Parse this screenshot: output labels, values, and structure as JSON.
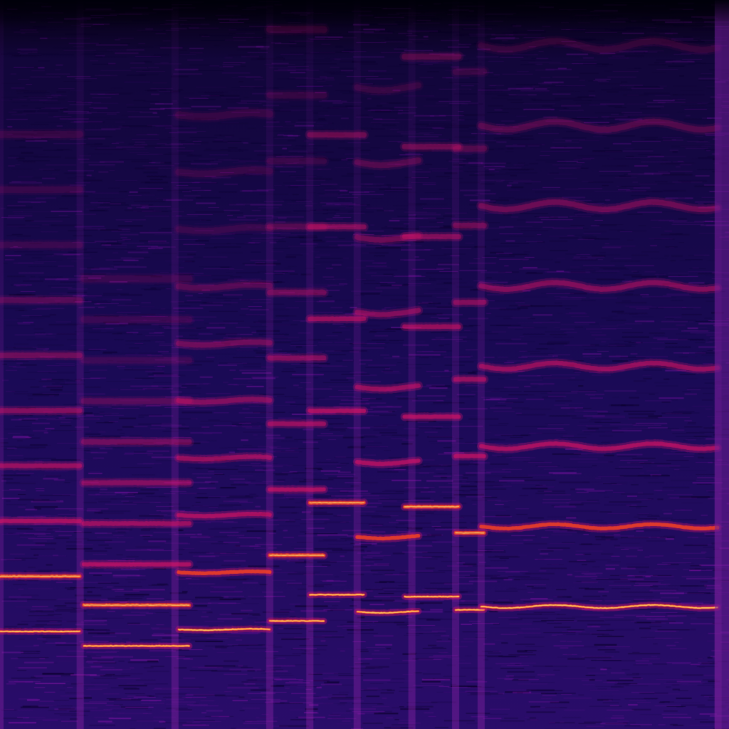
{
  "image": {
    "subject": "spectrogram",
    "colormap": "magma-like",
    "colors": {
      "background_top": "#05000f",
      "background_mid": "#1a0a55",
      "noise_violet": "#6a0a9a",
      "harmonic_low": "#d4146a",
      "harmonic_high": "#ff3a1a",
      "peak": "#ffe060"
    }
  },
  "segments": [
    {
      "t0": 0.0,
      "t1": 0.11,
      "f0": 0.082,
      "vib": 0.0,
      "n": 10
    },
    {
      "t0": 0.115,
      "t1": 0.26,
      "f0": 0.06,
      "vib": 0.0,
      "n": 10
    },
    {
      "t0": 0.245,
      "t1": 0.37,
      "f0": 0.085,
      "vib": 0.15,
      "n": 10
    },
    {
      "t0": 0.37,
      "t1": 0.445,
      "f0": 0.098,
      "vib": 0.0,
      "n": 10
    },
    {
      "t0": 0.425,
      "t1": 0.5,
      "f0": 0.138,
      "vib": 0.0,
      "n": 6
    },
    {
      "t0": 0.49,
      "t1": 0.575,
      "f0": 0.112,
      "vib": 0.25,
      "n": 8
    },
    {
      "t0": 0.555,
      "t1": 0.63,
      "f0": 0.135,
      "vib": 0.0,
      "n": 8
    },
    {
      "t0": 0.625,
      "t1": 0.665,
      "f0": 0.115,
      "vib": 0.0,
      "n": 8
    },
    {
      "t0": 0.66,
      "t1": 0.985,
      "f0": 0.12,
      "vib": 0.35,
      "n": 8
    }
  ]
}
